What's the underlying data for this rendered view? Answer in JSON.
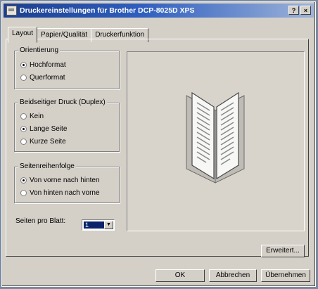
{
  "window": {
    "title": "Druckereinstellungen für Brother DCP-8025D XPS",
    "help_btn": "?",
    "close_btn": "×"
  },
  "tabs": [
    {
      "label": "Layout",
      "active": true
    },
    {
      "label": "Papier/Qualität",
      "active": false
    },
    {
      "label": "Druckerfunktion",
      "active": false
    }
  ],
  "orientation": {
    "title": "Orientierung",
    "options": [
      {
        "label": "Hochformat",
        "checked": true
      },
      {
        "label": "Querformat",
        "checked": false
      }
    ]
  },
  "duplex": {
    "title": "Beidseitiger Druck (Duplex)",
    "options": [
      {
        "label": "Kein",
        "checked": false
      },
      {
        "label": "Lange Seite",
        "checked": true
      },
      {
        "label": "Kurze Seite",
        "checked": false
      }
    ]
  },
  "page_order": {
    "title": "Seitenreihenfolge",
    "options": [
      {
        "label": "Von vorne nach hinten",
        "checked": true
      },
      {
        "label": "Von hinten nach vorne",
        "checked": false
      }
    ]
  },
  "pages_per_sheet": {
    "label": "Seiten pro Blatt:",
    "value": "1"
  },
  "buttons": {
    "advanced": "Erweitert...",
    "ok": "OK",
    "cancel": "Abbrechen",
    "apply": "Übernehmen"
  }
}
